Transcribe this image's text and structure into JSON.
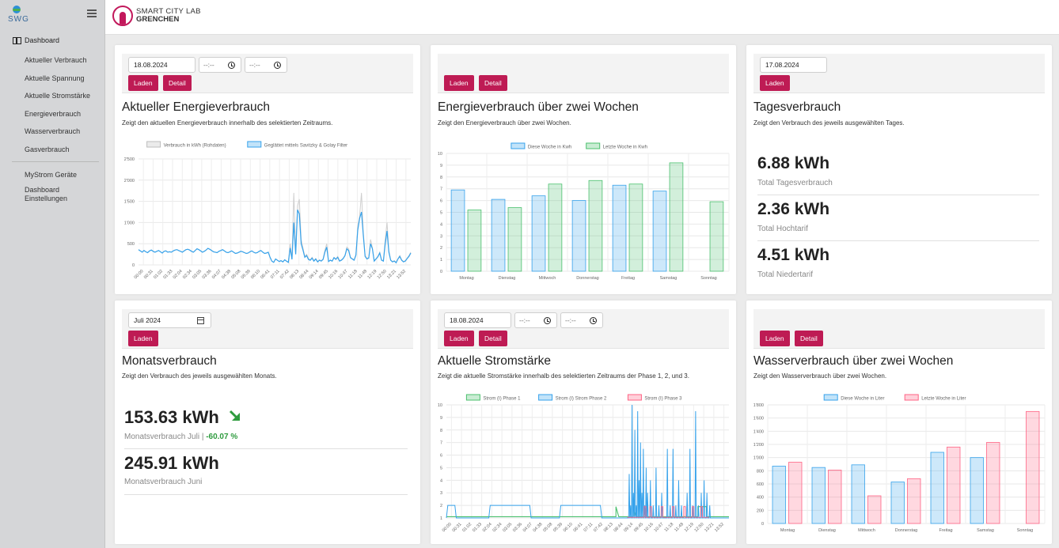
{
  "sidebar": {
    "logo_text": "SWG",
    "dashboard_label": "Dashboard",
    "items": [
      {
        "label": "Aktueller Verbrauch"
      },
      {
        "label": "Aktuelle Spannung"
      },
      {
        "label": "Aktuelle Stromstärke"
      },
      {
        "label": "Energieverbrauch"
      },
      {
        "label": "Wasserverbrauch"
      },
      {
        "label": "Gasverbrauch"
      }
    ],
    "items2": [
      {
        "label": "MyStrom Geräte"
      },
      {
        "label": "Dashboard Einstellungen"
      }
    ]
  },
  "header": {
    "brand_line1": "SMART CITY LAB",
    "brand_line2": "GRENCHEN"
  },
  "cards": {
    "energy_current": {
      "date": "18.08.2024",
      "time_from": "--:--",
      "time_to": "--:--",
      "load": "Laden",
      "detail": "Detail",
      "title": "Aktueller Energieverbrauch",
      "desc": "Zeigt den aktuellen Energieverbrauch innerhalb des selektierten Zeitraums."
    },
    "energy_weeks": {
      "load": "Laden",
      "detail": "Detail",
      "title": "Energieverbrauch über zwei Wochen",
      "desc": "Zeigt den Energieverbrauch über zwei Wochen."
    },
    "daily": {
      "date": "17.08.2024",
      "load": "Laden",
      "title": "Tagesverbrauch",
      "desc": "Zeigt den Verbrauch des jeweils ausgewählten Tages.",
      "m1_value": "6.88 kWh",
      "m1_label": "Total Tagesverbrauch",
      "m2_value": "2.36 kWh",
      "m2_label": "Total Hochtarif",
      "m3_value": "4.51 kWh",
      "m3_label": "Total Niedertarif"
    },
    "monthly": {
      "month": "Juli 2024",
      "load": "Laden",
      "title": "Monatsverbrauch",
      "desc": "Zeigt den Verbrauch des jeweils ausgewählten Monats.",
      "m1_value": "153.63 kWh",
      "m1_label": "Monatsverbrauch Juli | ",
      "m1_pct": "-60.07 %",
      "m2_value": "245.91 kWh",
      "m2_label": "Monatsverbrauch Juni"
    },
    "current": {
      "date": "18.08.2024",
      "time_from": "--:--",
      "time_to": "--:--",
      "load": "Laden",
      "detail": "Detail",
      "title": "Aktuelle Stromstärke",
      "desc": "Zeigt die aktuelle Stromstärke innerhalb des selektierten Zeitraums der Phase 1, 2, und 3."
    },
    "water": {
      "load": "Laden",
      "detail": "Detail",
      "title": "Wasserverbrauch über zwei Wochen",
      "desc": "Zeigt den Wasserverbrauch über zwei Wochen."
    }
  },
  "colors": {
    "accent": "#be1b54",
    "blue": "#36a2eb",
    "green": "#4bc06e",
    "red": "#ff6384",
    "gray": "#bdbdbd"
  },
  "chart_data": [
    {
      "type": "line",
      "series": [
        {
          "name": "Verbrauch in kWh (Rohdaten)",
          "color": "#c8c8c8",
          "values": [
            360,
            330,
            300,
            340,
            310,
            290,
            330,
            350,
            320,
            300,
            320,
            340,
            310,
            280,
            320,
            330,
            300,
            310,
            300,
            330,
            350,
            360,
            340,
            320,
            300,
            330,
            360,
            370,
            350,
            320,
            300,
            340,
            380,
            360,
            330,
            300,
            320,
            350,
            390,
            370,
            340,
            310,
            300,
            290,
            320,
            340,
            360,
            330,
            300,
            290,
            310,
            330,
            300,
            270,
            280,
            300,
            320,
            310,
            290,
            270,
            280,
            310,
            330,
            300,
            280,
            290,
            320,
            340,
            300,
            270,
            280,
            300,
            180,
            90,
            60,
            140,
            110,
            80,
            100,
            70,
            120,
            90,
            60,
            500,
            150,
            1700,
            300,
            1400,
            1550,
            600,
            400,
            200,
            250,
            150,
            120,
            180,
            100,
            150,
            80,
            120,
            100,
            140,
            350,
            500,
            80,
            120,
            90,
            180,
            140,
            200,
            100,
            120,
            160,
            230,
            420,
            380,
            180,
            150,
            120,
            250,
            900,
            1150,
            1700,
            780,
            220,
            150,
            180,
            600,
            400,
            100,
            150,
            200,
            300,
            120,
            100,
            600,
            1000,
            350,
            120,
            80,
            100,
            60,
            150,
            220,
            120,
            80,
            100,
            160,
            220,
            300
          ]
        },
        {
          "name": "Geglättet mittels Savitzky & Golay Filter",
          "color": "#36a2eb",
          "values": [
            360,
            330,
            300,
            340,
            310,
            290,
            330,
            350,
            320,
            300,
            320,
            340,
            310,
            280,
            320,
            330,
            300,
            310,
            300,
            330,
            350,
            360,
            340,
            320,
            300,
            330,
            360,
            370,
            350,
            320,
            300,
            340,
            380,
            360,
            330,
            300,
            320,
            350,
            390,
            370,
            340,
            310,
            300,
            290,
            320,
            340,
            360,
            330,
            300,
            290,
            310,
            330,
            300,
            270,
            280,
            300,
            320,
            310,
            290,
            270,
            280,
            310,
            330,
            300,
            280,
            290,
            320,
            340,
            300,
            270,
            280,
            300,
            180,
            90,
            60,
            140,
            110,
            80,
            100,
            70,
            120,
            90,
            60,
            400,
            130,
            1000,
            250,
            1300,
            1200,
            500,
            350,
            180,
            220,
            130,
            110,
            160,
            90,
            140,
            70,
            110,
            90,
            130,
            300,
            420,
            80,
            110,
            90,
            170,
            130,
            180,
            90,
            110,
            150,
            220,
            380,
            340,
            170,
            140,
            110,
            230,
            820,
            1100,
            1250,
            700,
            200,
            140,
            160,
            500,
            380,
            90,
            140,
            190,
            280,
            110,
            90,
            500,
            800,
            300,
            110,
            70,
            90,
            50,
            140,
            200,
            110,
            70,
            90,
            150,
            200,
            280
          ]
        }
      ],
      "x": [
        "00:00",
        "00:31",
        "01:02",
        "01:33",
        "02:04",
        "02:34",
        "03:05",
        "03:36",
        "04:07",
        "04:38",
        "05:08",
        "05:39",
        "06:10",
        "06:41",
        "07:11",
        "07:42",
        "08:13",
        "08:44",
        "09:14",
        "09:45",
        "10:16",
        "10:47",
        "11:18",
        "11:48",
        "12:19",
        "12:50",
        "13:21",
        "13:52"
      ],
      "ylim": [
        0,
        2500
      ],
      "yticks": [
        "0",
        "500",
        "1'000",
        "1'500",
        "2'000",
        "2'500"
      ]
    },
    {
      "type": "bar",
      "categories": [
        "Montag",
        "Dienstag",
        "Mittwoch",
        "Donnerstag",
        "Freitag",
        "Samstag",
        "Sonntag"
      ],
      "series": [
        {
          "name": "Diese Woche in Kwh",
          "values": [
            6.9,
            6.1,
            6.4,
            6.0,
            7.3,
            6.8,
            null
          ]
        },
        {
          "name": "Letzte Woche in Kwh",
          "values": [
            5.2,
            5.4,
            7.4,
            7.7,
            7.4,
            9.2,
            5.9
          ]
        }
      ],
      "ylim": [
        0,
        10
      ],
      "yticks": [
        "0",
        "1",
        "2",
        "3",
        "4",
        "5",
        "6",
        "7",
        "8",
        "9",
        "10"
      ]
    },
    {
      "type": "line",
      "series": [
        {
          "name": "Strom (I) Phase 1",
          "color": "#4bc06e"
        },
        {
          "name": "Strom (I) Strom Phase 2",
          "color": "#36a2eb"
        },
        {
          "name": "Strom (I) Phase 3",
          "color": "#ff6384"
        }
      ],
      "x": [
        "00:00",
        "00:31",
        "01:02",
        "01:33",
        "02:04",
        "02:34",
        "03:05",
        "03:36",
        "04:07",
        "04:38",
        "05:08",
        "05:39",
        "06:10",
        "06:41",
        "07:11",
        "07:42",
        "08:13",
        "08:44",
        "09:14",
        "09:45",
        "10:16",
        "10:47",
        "11:18",
        "11:48",
        "12:19",
        "12:50",
        "13:21",
        "13:52"
      ],
      "ylim": [
        1,
        10
      ],
      "yticks": [
        "1",
        "2",
        "3",
        "4",
        "5",
        "6",
        "7",
        "8",
        "9",
        "10"
      ]
    },
    {
      "type": "bar",
      "categories": [
        "Montag",
        "Dienstag",
        "Mittwoch",
        "Donnerstag",
        "Freitag",
        "Samstag",
        "Sonntag"
      ],
      "series": [
        {
          "name": "Diese Woche in Liter",
          "values": [
            870,
            850,
            890,
            630,
            1080,
            1000,
            null
          ]
        },
        {
          "name": "Letzte Woche in Liter",
          "values": [
            930,
            810,
            420,
            680,
            1160,
            1230,
            1700
          ]
        }
      ],
      "ylim": [
        0,
        1800
      ],
      "yticks": [
        "0",
        "200",
        "400",
        "600",
        "800",
        "1'000",
        "1'200",
        "1'400",
        "1'600",
        "1'800"
      ]
    }
  ]
}
